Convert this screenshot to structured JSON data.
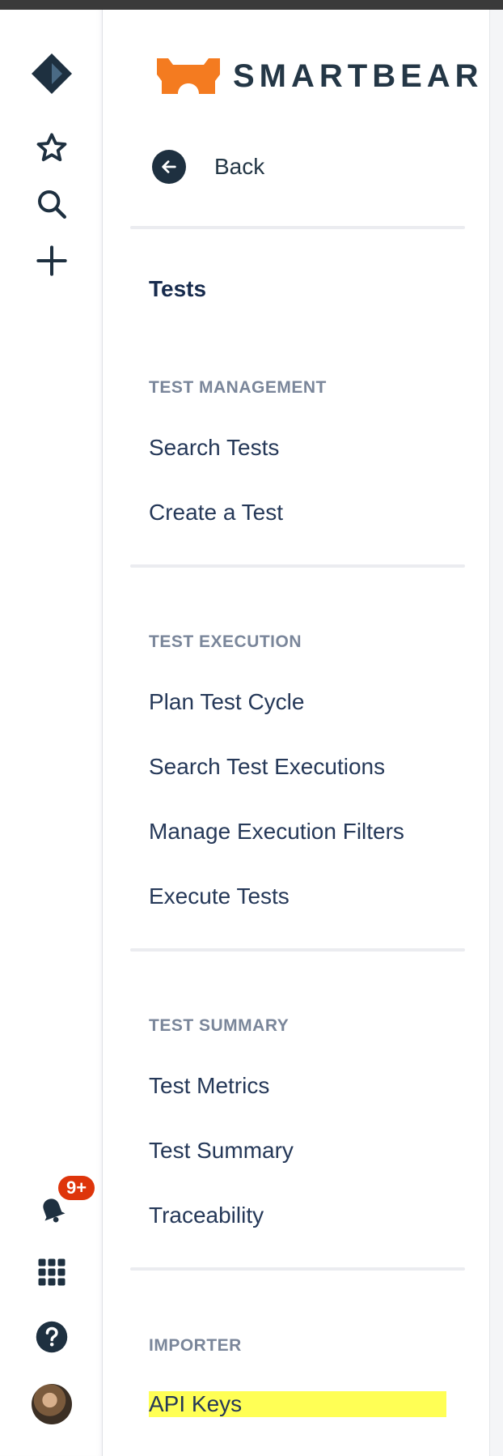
{
  "brand": {
    "name": "SMARTBEAR",
    "accent": "#f47b20"
  },
  "global_nav": {
    "icons": [
      "jira-logo-icon",
      "star-icon",
      "search-icon",
      "plus-icon",
      "bell-icon",
      "app-grid-icon",
      "help-icon"
    ],
    "notifications_badge": "9+"
  },
  "back": {
    "label": "Back"
  },
  "section": {
    "title": "Tests"
  },
  "groups": [
    {
      "heading": "TEST MANAGEMENT",
      "items": [
        "Search Tests",
        "Create a Test"
      ]
    },
    {
      "heading": "TEST EXECUTION",
      "items": [
        "Plan Test Cycle",
        "Search Test Executions",
        "Manage Execution Filters",
        "Execute Tests"
      ]
    },
    {
      "heading": "TEST SUMMARY",
      "items": [
        "Test Metrics",
        "Test Summary",
        "Traceability"
      ]
    },
    {
      "heading": "IMPORTER",
      "items": [
        "API Keys"
      ]
    }
  ],
  "colors": {
    "highlight": "#ffff55",
    "badge": "#de350b",
    "nav_text": "#253858"
  }
}
